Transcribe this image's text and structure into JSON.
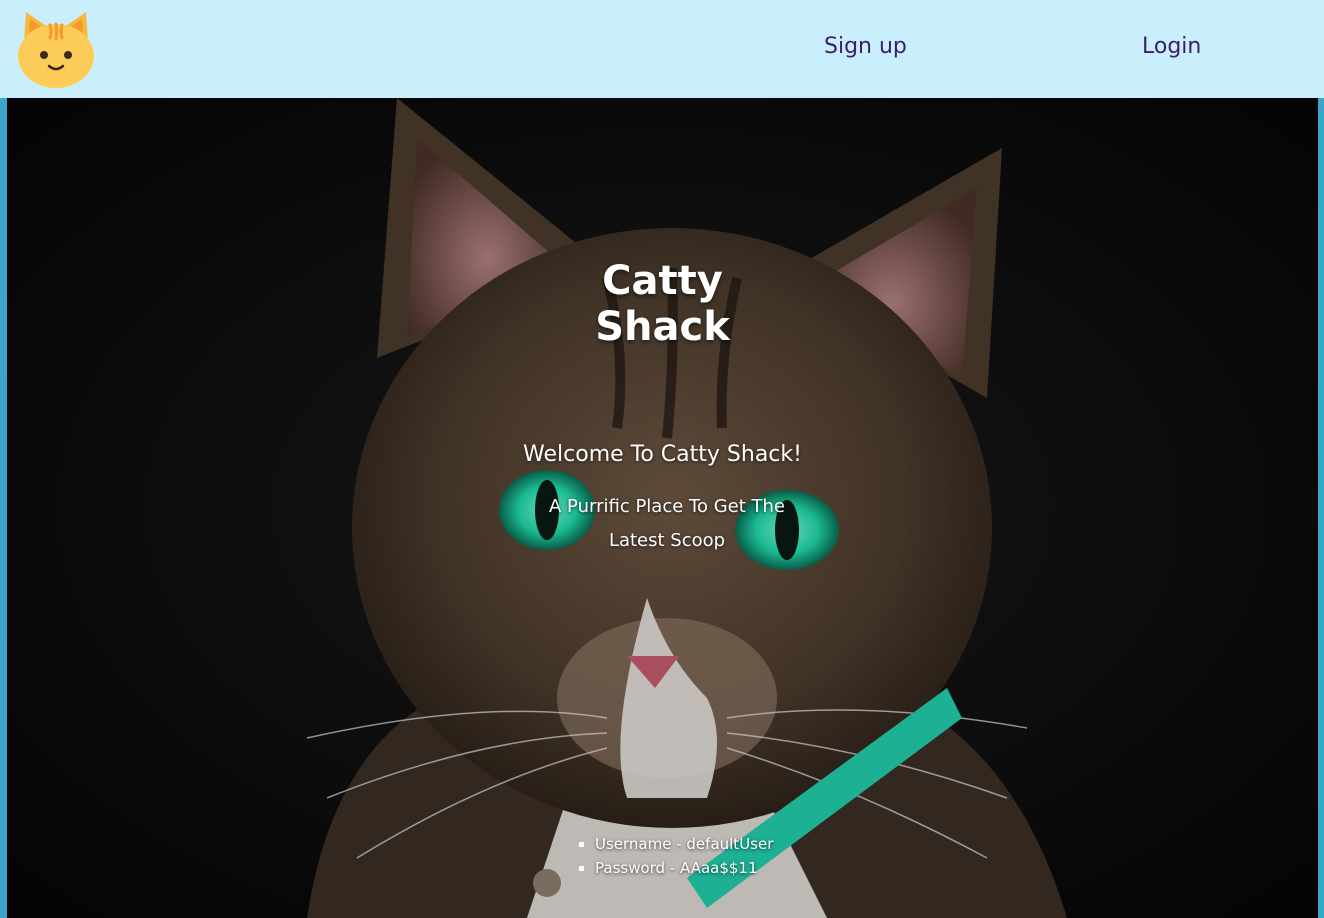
{
  "nav": {
    "logo_icon": "cat-face-icon",
    "signup_label": "Sign up",
    "login_label": "Login"
  },
  "hero": {
    "title_line1": "Catty",
    "title_line2": "Shack",
    "welcome": "Welcome To Catty Shack!",
    "tagline": "A Purrific Place To Get The Latest Scoop",
    "credentials": [
      "Username - defaultUser",
      "Password - AAaa$$11"
    ]
  },
  "colors": {
    "navbar_bg": "#c9eefc",
    "nav_link": "#3b1f6e",
    "page_border": "#3aa6c9",
    "eye_green": "#1fd3a6",
    "collar": "#22c9a8"
  }
}
